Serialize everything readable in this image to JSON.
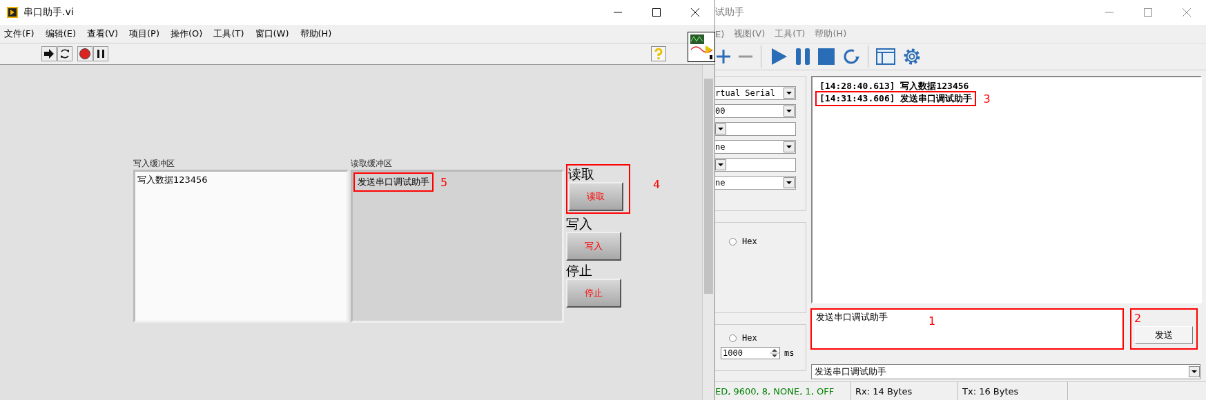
{
  "labview": {
    "title": "串口助手.vi",
    "menu": [
      "文件(F)",
      "编辑(E)",
      "查看(V)",
      "项目(P)",
      "操作(O)",
      "工具(T)",
      "窗口(W)",
      "帮助(H)"
    ],
    "write_buffer": {
      "label": "写入缓冲区",
      "value": "写入数据123456"
    },
    "read_buffer": {
      "label": "读取缓冲区",
      "value": "发送串口调试助手",
      "marker": "5"
    },
    "buttons": [
      {
        "label": "读取",
        "text": "读取",
        "marker": "4"
      },
      {
        "label": "写入",
        "text": "写入"
      },
      {
        "label": "停止",
        "text": "停止"
      }
    ]
  },
  "assistant": {
    "title": "试助手",
    "menu": [
      "E)",
      "视图(V)",
      "工具(T)",
      "帮助(H)"
    ],
    "port_settings": [
      {
        "kind": "dropdown",
        "value": "rtual Serial"
      },
      {
        "kind": "dropdown",
        "value": "00"
      },
      {
        "kind": "dropdown"
      },
      {
        "kind": "dropdown",
        "value": "ne"
      },
      {
        "kind": "dropdown"
      },
      {
        "kind": "dropdown",
        "value": "ne"
      }
    ],
    "receive_hex": {
      "label": "Hex",
      "selected": false
    },
    "log": [
      {
        "text": "[14:28:40.613] 写入数据123456"
      },
      {
        "text": "[14:31:43.606] 发送串口调试助手",
        "marker": "3"
      }
    ],
    "send_field": {
      "value": "发送串口调试助手",
      "marker": "1"
    },
    "send_button": {
      "label": "发送",
      "marker": "2"
    },
    "send_hex": {
      "label": "Hex",
      "selected": false
    },
    "interval": {
      "value": "1000",
      "unit": "ms"
    },
    "history": "发送串口调试助手",
    "status": [
      {
        "text": "ED, 9600, 8, NONE, 1, OFF",
        "color": "#008000"
      },
      {
        "text": "Rx: 14 Bytes",
        "color": "#000000"
      },
      {
        "text": "Tx: 16 Bytes",
        "color": "#000000"
      }
    ]
  }
}
